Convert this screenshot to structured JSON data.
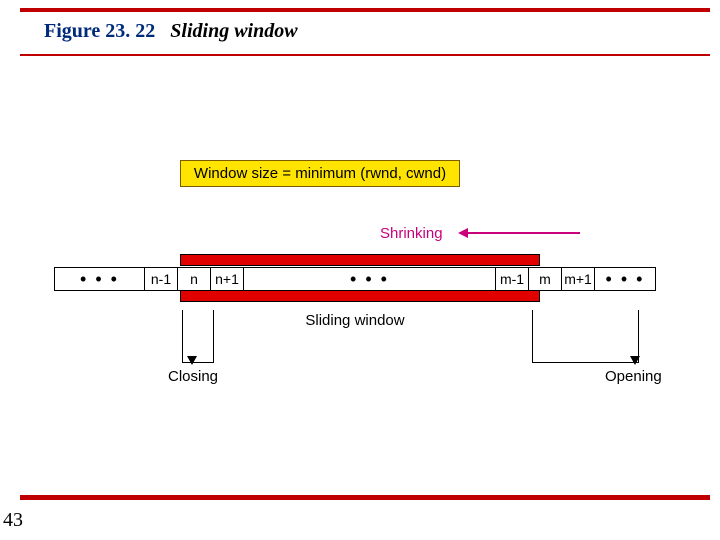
{
  "figure": {
    "number": "Figure 23. 22",
    "caption": "Sliding window"
  },
  "page": "43",
  "formula": "Window size = minimum (rwnd, cwnd)",
  "labels": {
    "shrinking": "Shrinking",
    "sliding": "Sliding window",
    "closing": "Closing",
    "opening": "Opening"
  },
  "cells": {
    "dots": "• • •",
    "n_1": "n-1",
    "n": "n",
    "np1": "n+1",
    "m_1": "m-1",
    "m": "m",
    "mp1": "m+1"
  }
}
